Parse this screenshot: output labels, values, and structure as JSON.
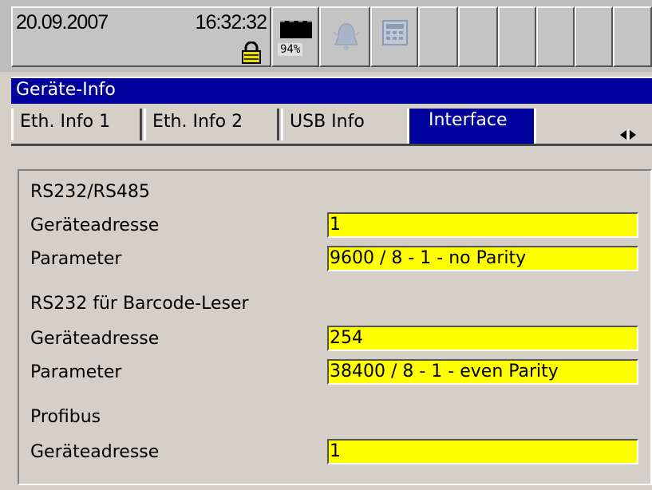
{
  "statusbar": {
    "date": "20.09.2007",
    "time": "16:32:32",
    "battery_percent": "94%",
    "icons": [
      "lock-icon",
      "battery-icon",
      "alarm-bell-icon",
      "keypad-icon"
    ]
  },
  "window": {
    "title": "Geräte-Info"
  },
  "tabs": [
    {
      "label": "Eth. Info 1",
      "active": false
    },
    {
      "label": "Eth. Info 2",
      "active": false
    },
    {
      "label": "USB Info",
      "active": false
    },
    {
      "label": "Interface",
      "active": true
    }
  ],
  "sections": [
    {
      "title": "RS232/RS485",
      "fields": [
        {
          "label": "Geräteadresse",
          "value": "1"
        },
        {
          "label": "Parameter",
          "value": "9600 / 8 - 1 - no Parity"
        }
      ]
    },
    {
      "title": "RS232 für Barcode-Leser",
      "fields": [
        {
          "label": "Geräteadresse",
          "value": "254"
        },
        {
          "label": "Parameter",
          "value": "38400 / 8 - 1 - even Parity"
        }
      ]
    },
    {
      "title": "Profibus",
      "fields": [
        {
          "label": "Geräteadresse",
          "value": "1"
        }
      ]
    }
  ],
  "colors": {
    "title_bar": "#00009c",
    "field_background": "#ffff00",
    "window_background": "#d4d0c8"
  }
}
